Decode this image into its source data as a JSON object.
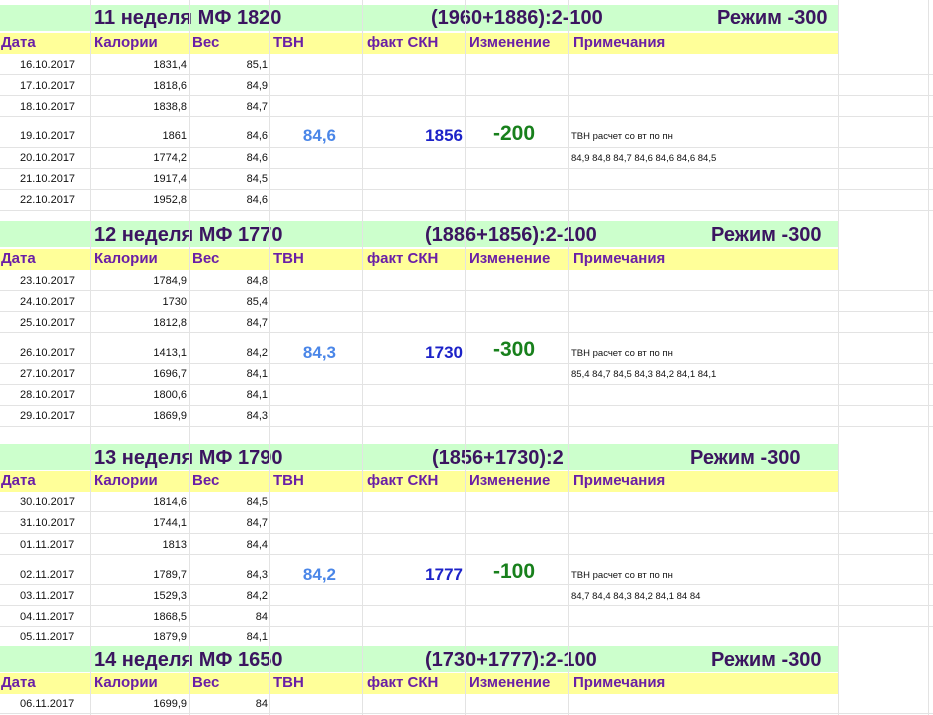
{
  "headers": {
    "date": "Дата",
    "calories": "Калории",
    "weight": "Вес",
    "tvn": "ТВН",
    "fact_skn": "факт СКН",
    "change": "Изменение",
    "notes": "Примечания"
  },
  "weeks": [
    {
      "title": "11  неделя МФ  1820",
      "formula": "(1960+1886):2-100",
      "mode": "Режим  -300",
      "rows": [
        {
          "date": "16.10.2017",
          "calories": "1831,4",
          "weight": "85,1"
        },
        {
          "date": "17.10.2017",
          "calories": "1818,6",
          "weight": "84,9"
        },
        {
          "date": "18.10.2017",
          "calories": "1838,8",
          "weight": "84,7"
        },
        {
          "date": "19.10.2017",
          "calories": "1861",
          "weight": "84,6"
        },
        {
          "date": "20.10.2017",
          "calories": "1774,2",
          "weight": "84,6"
        },
        {
          "date": "21.10.2017",
          "calories": "1917,4",
          "weight": "84,5"
        },
        {
          "date": "22.10.2017",
          "calories": "1952,8",
          "weight": "84,6"
        }
      ],
      "tvn": "84,6",
      "fact_skn": "1856",
      "change": "-200",
      "note1": "ТВН расчет со вт по пн",
      "note2": "84,9  84,8  84,7  84,6  84,6  84,6  84,5"
    },
    {
      "title": "12 неделя МФ  1770",
      "formula": "(1886+1856):2-100",
      "mode": "Режим  -300",
      "rows": [
        {
          "date": "23.10.2017",
          "calories": "1784,9",
          "weight": "84,8"
        },
        {
          "date": "24.10.2017",
          "calories": "1730",
          "weight": "85,4"
        },
        {
          "date": "25.10.2017",
          "calories": "1812,8",
          "weight": "84,7"
        },
        {
          "date": "26.10.2017",
          "calories": "1413,1",
          "weight": "84,2"
        },
        {
          "date": "27.10.2017",
          "calories": "1696,7",
          "weight": "84,1"
        },
        {
          "date": "28.10.2017",
          "calories": "1800,6",
          "weight": "84,1"
        },
        {
          "date": "29.10.2017",
          "calories": "1869,9",
          "weight": "84,3"
        }
      ],
      "tvn": "84,3",
      "fact_skn": "1730",
      "change": "-300",
      "note1": "ТВН расчет со вт по пн",
      "note2": "85,4  84,7  84,5  84,3  84,2  84,1  84,1"
    },
    {
      "title": "13  неделя МФ  1790",
      "formula": "(1856+1730):2",
      "mode": "Режим  -300",
      "rows": [
        {
          "date": "30.10.2017",
          "calories": "1814,6",
          "weight": "84,5"
        },
        {
          "date": "31.10.2017",
          "calories": "1744,1",
          "weight": "84,7"
        },
        {
          "date": "01.11.2017",
          "calories": "1813",
          "weight": "84,4"
        },
        {
          "date": "02.11.2017",
          "calories": "1789,7",
          "weight": "84,3"
        },
        {
          "date": "03.11.2017",
          "calories": "1529,3",
          "weight": "84,2"
        },
        {
          "date": "04.11.2017",
          "calories": "1868,5",
          "weight": "84"
        },
        {
          "date": "05.11.2017",
          "calories": "1879,9",
          "weight": "84,1"
        }
      ],
      "tvn": "84,2",
      "fact_skn": "1777",
      "change": "-100",
      "note1": "ТВН расчет со вт по пн",
      "note2": "84,7  84,4  84,3  84,2  84,1  84  84"
    },
    {
      "title": "14  неделя МФ  1650",
      "formula": "(1730+1777):2-100",
      "mode": "Режим  -300",
      "rows": [
        {
          "date": "06.11.2017",
          "calories": "1699,9",
          "weight": "84"
        }
      ]
    }
  ]
}
